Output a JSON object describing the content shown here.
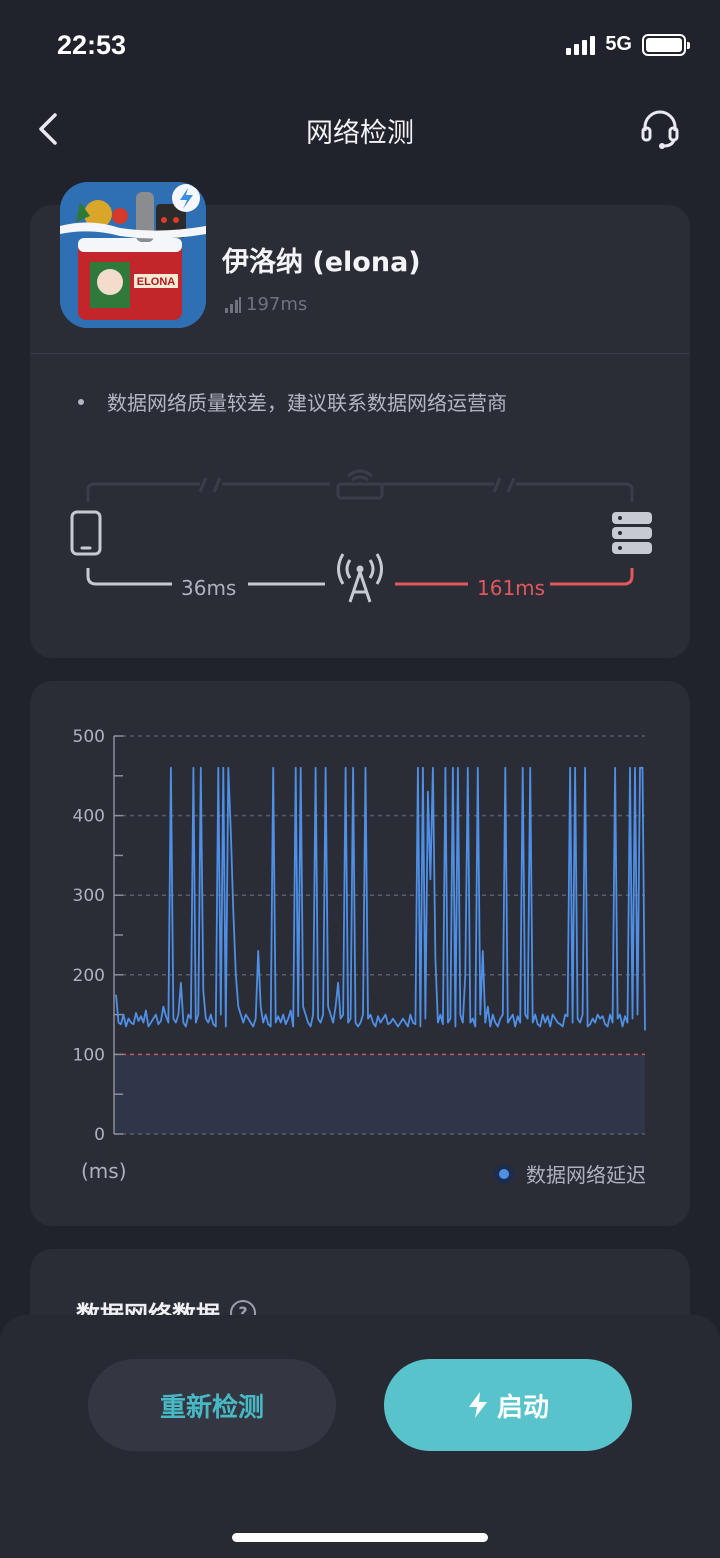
{
  "status_bar": {
    "time": "22:53",
    "network": "5G"
  },
  "nav": {
    "title": "网络检测"
  },
  "game": {
    "name": "伊洛纳 (elona)",
    "ping": "197ms",
    "icon_text": "ELONA"
  },
  "tip": {
    "text": "数据网络质量较差，建议联系数据网络运营商"
  },
  "route": {
    "device_to_tower": "36ms",
    "tower_to_server": "161ms"
  },
  "colors": {
    "background": "#20232b",
    "card": "#2a2d36",
    "accent": "#59c3cc",
    "series": "#4f8fe6",
    "warning": "#e2565c"
  },
  "chart_data": {
    "type": "line",
    "ylim": [
      0,
      500
    ],
    "yticks": [
      "500",
      "400",
      "300",
      "200",
      "100",
      "0"
    ],
    "ylabel": "(ms)",
    "threshold": 100,
    "legend_position": "bottom-right",
    "grid": true,
    "series": [
      {
        "name": "数据网络延迟",
        "values": [
          175,
          140,
          138,
          150,
          135,
          145,
          140,
          138,
          152,
          142,
          148,
          140,
          155,
          135,
          140,
          145,
          150,
          138,
          142,
          160,
          148,
          140,
          460,
          145,
          140,
          150,
          190,
          140,
          135,
          150,
          145,
          460,
          140,
          150,
          460,
          180,
          145,
          140,
          150,
          138,
          135,
          460,
          150,
          460,
          135,
          460,
          380,
          280,
          200,
          160,
          150,
          140,
          150,
          145,
          140,
          135,
          145,
          230,
          160,
          140,
          150,
          138,
          135,
          460,
          140,
          148,
          140,
          150,
          138,
          145,
          155,
          135,
          460,
          148,
          460,
          160,
          150,
          140,
          135,
          150,
          460,
          145,
          140,
          150,
          460,
          160,
          150,
          140,
          160,
          190,
          145,
          150,
          460,
          140,
          145,
          460,
          140,
          135,
          140,
          150,
          460,
          145,
          150,
          140,
          135,
          148,
          140,
          145,
          150,
          138,
          140,
          145,
          140,
          135,
          140,
          145,
          140,
          135,
          150,
          140,
          138,
          460,
          135,
          460,
          145,
          430,
          320,
          460,
          220,
          140,
          150,
          138,
          460,
          140,
          145,
          460,
          135,
          460,
          150,
          140,
          200,
          460,
          140,
          145,
          135,
          460,
          150,
          230,
          140,
          160,
          135,
          150,
          140,
          135,
          145,
          150,
          460,
          140,
          145,
          150,
          135,
          148,
          140,
          460,
          150,
          145,
          460,
          140,
          150,
          138,
          135,
          150,
          140,
          148,
          135,
          150,
          145,
          140,
          138,
          135,
          150,
          148,
          460,
          140,
          460,
          145,
          140,
          150,
          460,
          135,
          138,
          145,
          140,
          150,
          145,
          148,
          138,
          135,
          150,
          140,
          460,
          145,
          150,
          135,
          148,
          140,
          460,
          145,
          460,
          150,
          460,
          460,
          130
        ]
      }
    ]
  },
  "data_section": {
    "title": "数据网络数据"
  },
  "buttons": {
    "retest": "重新检测",
    "start": "启动"
  }
}
